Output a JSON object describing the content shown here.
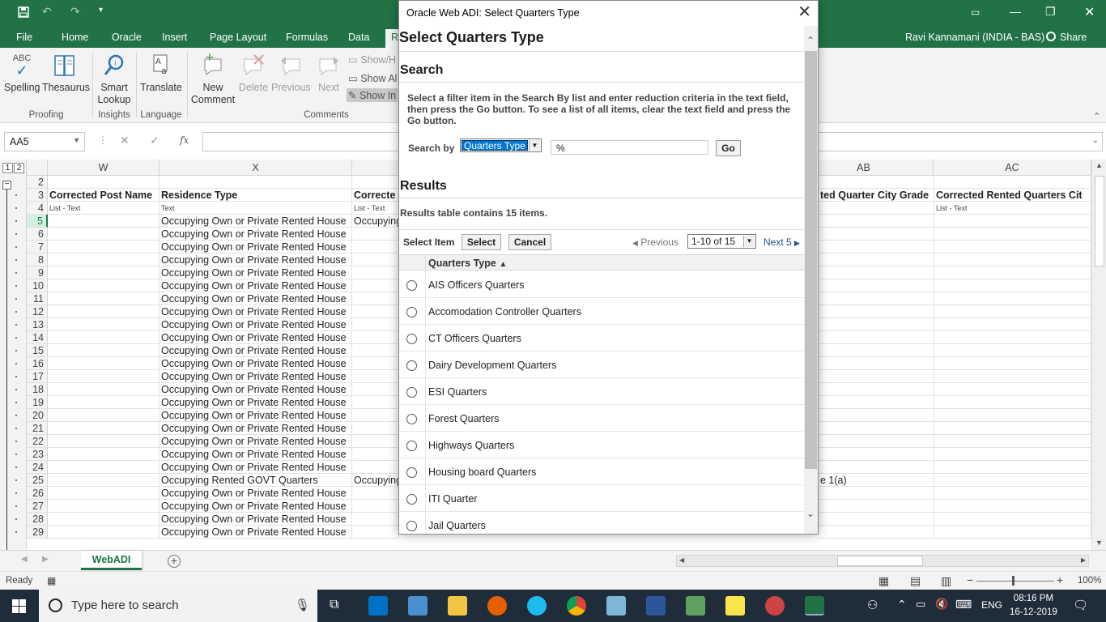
{
  "excel": {
    "ribbon_tabs": [
      "File",
      "Home",
      "Oracle",
      "Insert",
      "Page Layout",
      "Formulas",
      "Data",
      "R"
    ],
    "user": "Ravi Kannamani (INDIA - BAS)",
    "share_label": "Share",
    "ribbon": {
      "spelling": "Spelling",
      "thesaurus": "Thesaurus",
      "smart_lookup_1": "Smart",
      "smart_lookup_2": "Lookup",
      "translate": "Translate",
      "new_comment_1": "New",
      "new_comment_2": "Comment",
      "delete": "Delete",
      "previous": "Previous",
      "next": "Next",
      "show_hide": "Show/H",
      "show_all": "Show Al",
      "show_ink": "Show In",
      "groups": {
        "proofing": "Proofing",
        "insights": "Insights",
        "language": "Language",
        "comments": "Comments"
      }
    },
    "name_box": "AA5",
    "fx_label": "fx",
    "columns": [
      {
        "label": "W"
      },
      {
        "label": "X"
      },
      {
        "label": "AB"
      },
      {
        "label": "AC"
      }
    ],
    "row_headers": [
      "2",
      "3",
      "4",
      "5",
      "6",
      "7",
      "8",
      "9",
      "10",
      "11",
      "12",
      "13",
      "14",
      "15",
      "16",
      "17",
      "18",
      "19",
      "20",
      "21",
      "22",
      "23",
      "24",
      "25",
      "26",
      "27",
      "28",
      "29"
    ],
    "col_w": {
      "title": "Corrected Post Name",
      "subtitle": "List - Text"
    },
    "col_x": {
      "title": "Residence Type",
      "subtitle": "Text",
      "values": [
        "Occupying Own or Private Rented House",
        "Occupying Own or Private Rented House",
        "Occupying Own or Private Rented House",
        "Occupying Own or Private Rented House",
        "Occupying Own or Private Rented House",
        "Occupying Own or Private Rented House",
        "Occupying Own or Private Rented House",
        "Occupying Own or Private Rented House",
        "Occupying Own or Private Rented House",
        "Occupying Own or Private Rented House",
        "Occupying Own or Private Rented House",
        "Occupying Own or Private Rented House",
        "Occupying Own or Private Rented House",
        "Occupying Own or Private Rented House",
        "Occupying Own or Private Rented House",
        "Occupying Own or Private Rented House",
        "Occupying Own or Private Rented House",
        "Occupying Own or Private Rented House",
        "Occupying Own or Private Rented House",
        "Occupying Own or Private Rented House",
        "Occupying Rented GOVT Quarters",
        "Occupying Own or Private Rented House",
        "Occupying Own or Private Rented House",
        "Occupying Own or Private Rented House",
        "Occupying Own or Private Rented House"
      ]
    },
    "col_y": {
      "title": "Correcte",
      "subtitle": "List - Text",
      "row5": "Occupying",
      "row25": "Occupying"
    },
    "col_ab": {
      "title": "ted Quarter City Grade",
      "row25": "e 1(a)"
    },
    "col_ac": {
      "title": "Corrected Rented Quarters Cit",
      "subtitle": "List - Text"
    },
    "sheet_tab": "WebADI",
    "status": "Ready",
    "zoom": "100%"
  },
  "taskbar": {
    "search_placeholder": "Type here to search",
    "lang": "ENG",
    "time": "08:16 PM",
    "date": "16-12-2019"
  },
  "dialog": {
    "window_title": "Oracle Web ADI: Select Quarters Type",
    "heading": "Select Quarters Type",
    "search_heading": "Search",
    "instructions": "Select a filter item in the Search By list and enter reduction criteria in the text field, then press the Go button. To see a list of all items, clear the text field and press the Go button.",
    "search_by_label": "Search by",
    "search_by_value": "Quarters Type",
    "search_value": "%",
    "go_label": "Go",
    "results_heading": "Results",
    "results_count": "Results table contains 15 items.",
    "select_item_label": "Select Item",
    "select_label": "Select",
    "cancel_label": "Cancel",
    "previous_label": "Previous",
    "range_value": "1-10 of 15",
    "next_label": "Next 5",
    "column_header": "Quarters Type",
    "items": [
      "AIS Officers Quarters",
      "Accomodation Controller Quarters",
      "CT Officers Quarters",
      "Dairy Development Quarters",
      "ESI Quarters",
      "Forest Quarters",
      "Highways Quarters",
      "Housing board Quarters",
      "ITI Quarter",
      "Jail Quarters"
    ]
  }
}
